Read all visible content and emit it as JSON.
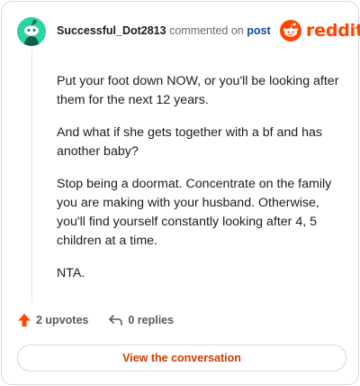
{
  "comment": {
    "username": "Successful_Dot2813",
    "meta_text": "commented on",
    "post_link": "post",
    "paragraphs": [
      "Put your foot down NOW, or you'll be looking after them for the next 12 years.",
      "And what if she gets together with a bf and has another baby?",
      "Stop being a doormat. Concentrate on the family you are making with your husband. Otherwise, you'll find yourself constantly looking after 4, 5 children at a time.",
      "NTA."
    ]
  },
  "brand": {
    "name": "reddit",
    "color": "#ff4500"
  },
  "actions": {
    "upvotes_label": "2 upvotes",
    "replies_label": "0 replies"
  },
  "cta": {
    "label": "View the conversation"
  },
  "icons": {
    "avatar": "snoo-avatar-icon",
    "logo": "reddit-logo-icon",
    "upvote": "upvote-arrow-icon",
    "reply": "reply-arrow-icon"
  },
  "colors": {
    "avatar_bg": "#2fd3a2",
    "accent": "#ff4500",
    "link": "#0a4aa8",
    "cta_text": "#d93a00"
  }
}
